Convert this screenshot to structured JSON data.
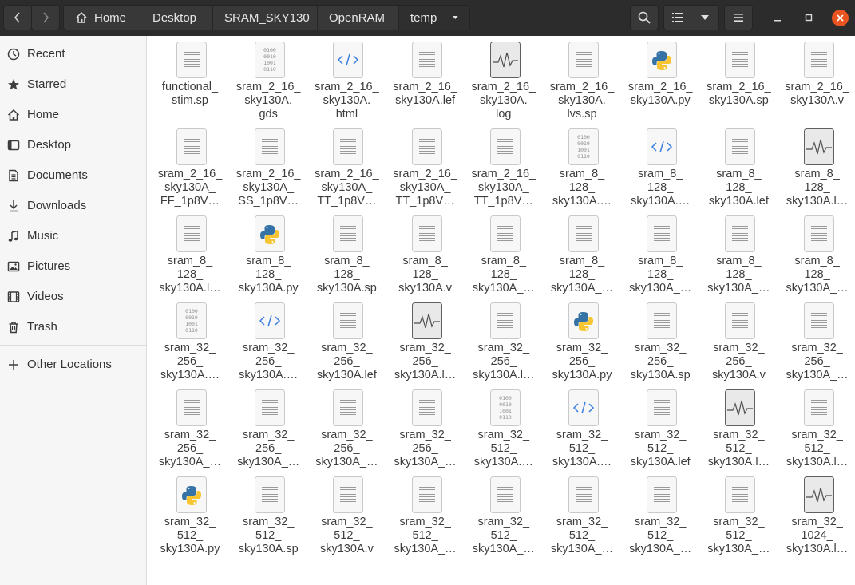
{
  "header": {
    "breadcrumbs": [
      "Home",
      "Desktop",
      "SRAM_SKY130",
      "OpenRAM",
      "temp"
    ]
  },
  "sidebar": {
    "items": [
      {
        "label": "Recent",
        "icon": "clock-icon"
      },
      {
        "label": "Starred",
        "icon": "star-icon"
      },
      {
        "label": "Home",
        "icon": "home-icon"
      },
      {
        "label": "Desktop",
        "icon": "desktop-icon"
      },
      {
        "label": "Documents",
        "icon": "documents-icon"
      },
      {
        "label": "Downloads",
        "icon": "downloads-icon"
      },
      {
        "label": "Music",
        "icon": "music-icon"
      },
      {
        "label": "Pictures",
        "icon": "pictures-icon"
      },
      {
        "label": "Videos",
        "icon": "videos-icon"
      },
      {
        "label": "Trash",
        "icon": "trash-icon"
      }
    ],
    "other_locations": "Other Locations"
  },
  "files": [
    {
      "name": "functional_\nstim.sp",
      "type": "text"
    },
    {
      "name": "sram_2_16_\nsky130A.\ngds",
      "type": "binary"
    },
    {
      "name": "sram_2_16_\nsky130A.\nhtml",
      "type": "html"
    },
    {
      "name": "sram_2_16_\nsky130A.lef",
      "type": "text"
    },
    {
      "name": "sram_2_16_\nsky130A.\nlog",
      "type": "log"
    },
    {
      "name": "sram_2_16_\nsky130A.\nlvs.sp",
      "type": "text"
    },
    {
      "name": "sram_2_16_\nsky130A.py",
      "type": "python"
    },
    {
      "name": "sram_2_16_\nsky130A.sp",
      "type": "text"
    },
    {
      "name": "sram_2_16_\nsky130A.v",
      "type": "text"
    },
    {
      "name": "sram_2_16_\nsky130A_\nFF_1p8V…",
      "type": "text"
    },
    {
      "name": "sram_2_16_\nsky130A_\nSS_1p8V…",
      "type": "text"
    },
    {
      "name": "sram_2_16_\nsky130A_\nTT_1p8V…",
      "type": "text"
    },
    {
      "name": "sram_2_16_\nsky130A_\nTT_1p8V…",
      "type": "text"
    },
    {
      "name": "sram_2_16_\nsky130A_\nTT_1p8V…",
      "type": "text"
    },
    {
      "name": "sram_8_\n128_\nsky130A.…",
      "type": "binary"
    },
    {
      "name": "sram_8_\n128_\nsky130A.…",
      "type": "html"
    },
    {
      "name": "sram_8_\n128_\nsky130A.lef",
      "type": "text"
    },
    {
      "name": "sram_8_\n128_\nsky130A.l…",
      "type": "log"
    },
    {
      "name": "sram_8_\n128_\nsky130A.l…",
      "type": "text"
    },
    {
      "name": "sram_8_\n128_\nsky130A.py",
      "type": "python"
    },
    {
      "name": "sram_8_\n128_\nsky130A.sp",
      "type": "text"
    },
    {
      "name": "sram_8_\n128_\nsky130A.v",
      "type": "text"
    },
    {
      "name": "sram_8_\n128_\nsky130A_…",
      "type": "text"
    },
    {
      "name": "sram_8_\n128_\nsky130A_…",
      "type": "text"
    },
    {
      "name": "sram_8_\n128_\nsky130A_…",
      "type": "text"
    },
    {
      "name": "sram_8_\n128_\nsky130A_…",
      "type": "text"
    },
    {
      "name": "sram_8_\n128_\nsky130A_…",
      "type": "text"
    },
    {
      "name": "sram_32_\n256_\nsky130A.…",
      "type": "binary"
    },
    {
      "name": "sram_32_\n256_\nsky130A.…",
      "type": "html"
    },
    {
      "name": "sram_32_\n256_\nsky130A.lef",
      "type": "text"
    },
    {
      "name": "sram_32_\n256_\nsky130A.l…",
      "type": "log"
    },
    {
      "name": "sram_32_\n256_\nsky130A.l…",
      "type": "text"
    },
    {
      "name": "sram_32_\n256_\nsky130A.py",
      "type": "python"
    },
    {
      "name": "sram_32_\n256_\nsky130A.sp",
      "type": "text"
    },
    {
      "name": "sram_32_\n256_\nsky130A.v",
      "type": "text"
    },
    {
      "name": "sram_32_\n256_\nsky130A_…",
      "type": "text"
    },
    {
      "name": "sram_32_\n256_\nsky130A_…",
      "type": "text"
    },
    {
      "name": "sram_32_\n256_\nsky130A_…",
      "type": "text"
    },
    {
      "name": "sram_32_\n256_\nsky130A_…",
      "type": "text"
    },
    {
      "name": "sram_32_\n256_\nsky130A_…",
      "type": "text"
    },
    {
      "name": "sram_32_\n512_\nsky130A.…",
      "type": "binary"
    },
    {
      "name": "sram_32_\n512_\nsky130A.…",
      "type": "html"
    },
    {
      "name": "sram_32_\n512_\nsky130A.lef",
      "type": "text"
    },
    {
      "name": "sram_32_\n512_\nsky130A.l…",
      "type": "log"
    },
    {
      "name": "sram_32_\n512_\nsky130A.l…",
      "type": "text"
    },
    {
      "name": "sram_32_\n512_\nsky130A.py",
      "type": "python"
    },
    {
      "name": "sram_32_\n512_\nsky130A.sp",
      "type": "text"
    },
    {
      "name": "sram_32_\n512_\nsky130A.v",
      "type": "text"
    },
    {
      "name": "sram_32_\n512_\nsky130A_…",
      "type": "text"
    },
    {
      "name": "sram_32_\n512_\nsky130A_…",
      "type": "text"
    },
    {
      "name": "sram_32_\n512_\nsky130A_…",
      "type": "text"
    },
    {
      "name": "sram_32_\n512_\nsky130A_…",
      "type": "text"
    },
    {
      "name": "sram_32_\n512_\nsky130A_…",
      "type": "text"
    },
    {
      "name": "sram_32_\n1024_\nsky130A.l…",
      "type": "log"
    }
  ]
}
